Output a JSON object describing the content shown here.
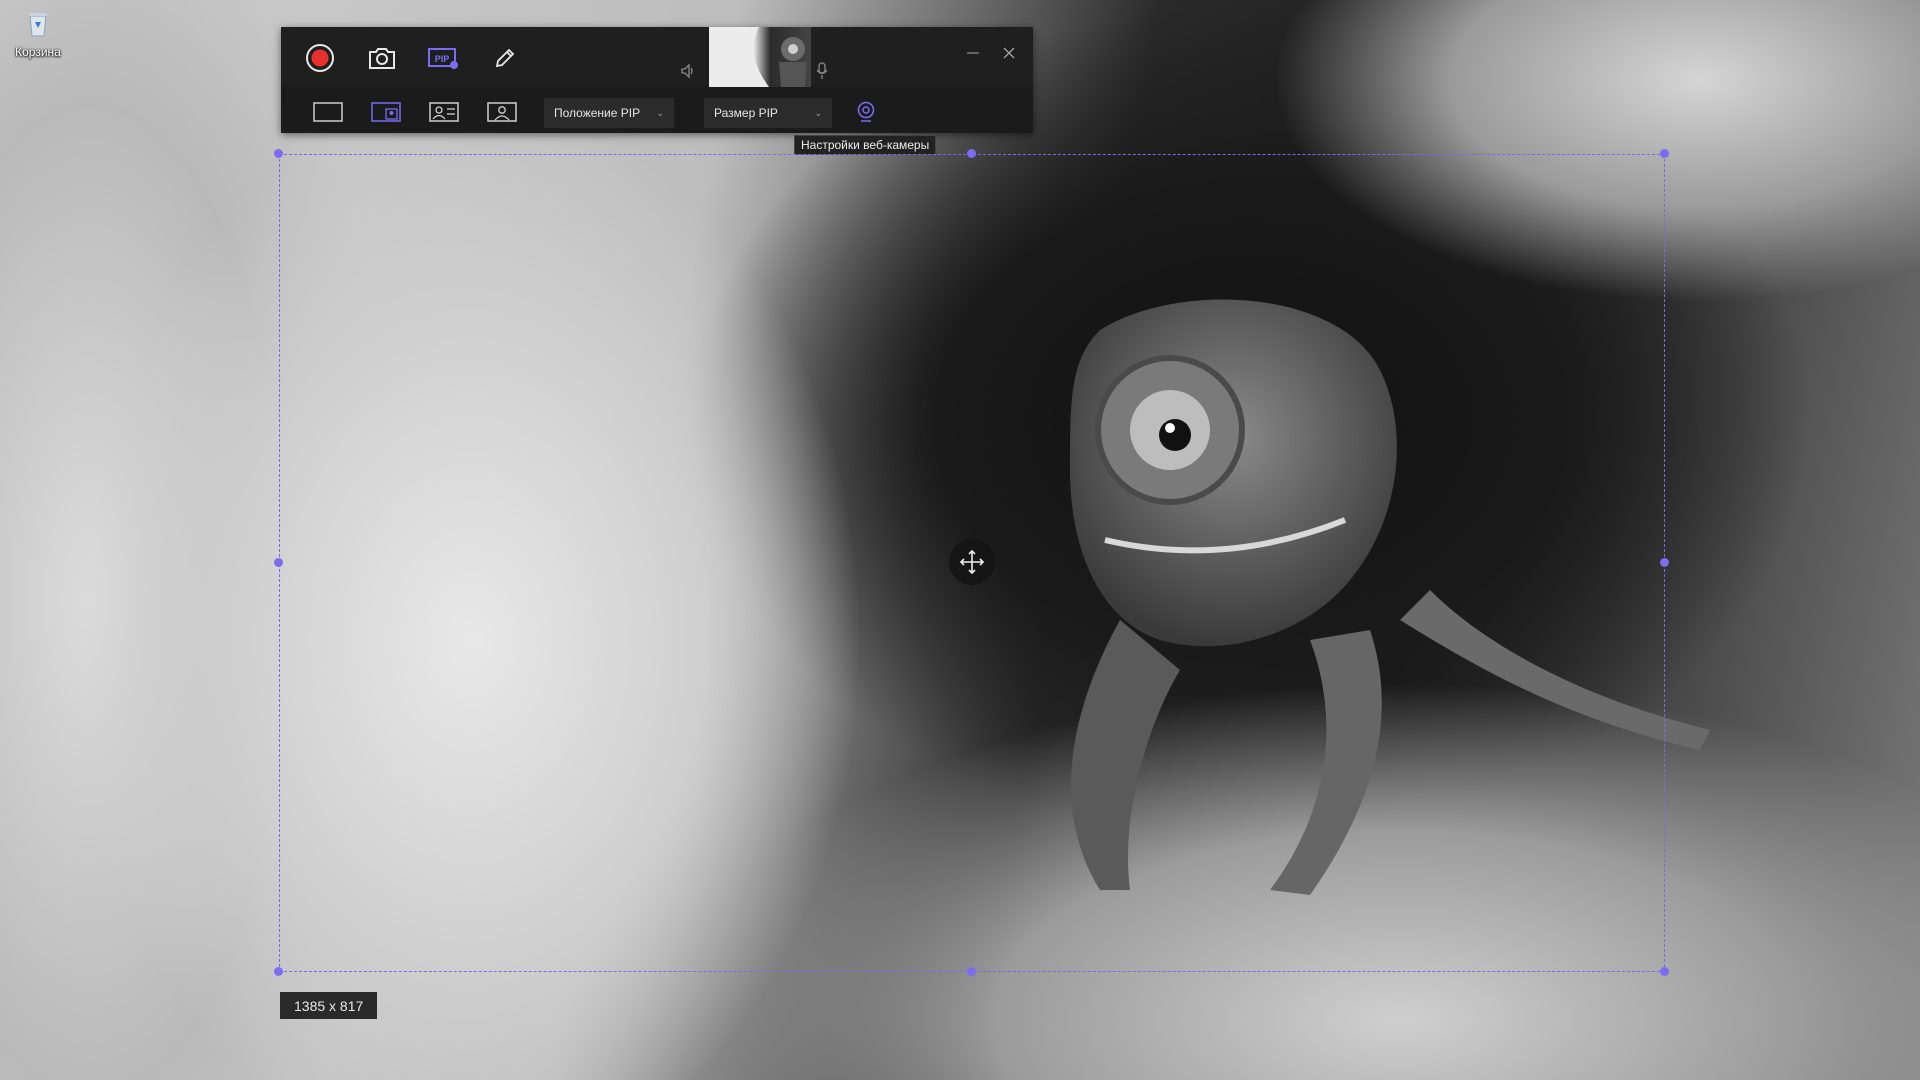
{
  "desktop": {
    "recycle_bin_label": "Корзина"
  },
  "toolbar": {
    "record_icon": "record-icon",
    "screenshot_icon": "camera-icon",
    "pip_label": "PIP",
    "annotate_icon": "pencil-icon",
    "speaker_icon": "speaker-icon",
    "mic_icon": "microphone-icon",
    "minimize_icon": "minimize-icon",
    "close_icon": "close-icon",
    "layouts": [
      "screen-only",
      "pip-small",
      "pip-side",
      "camera-only"
    ],
    "pip_position_label": "Положение PIP",
    "pip_size_label": "Размер PIP",
    "webcam_settings_icon": "webcam-icon",
    "tooltip": "Настройки веб-камеры",
    "accent_color": "#7b6cf2",
    "record_color": "#e8312f"
  },
  "region": {
    "size_label": "1385 x 817"
  }
}
